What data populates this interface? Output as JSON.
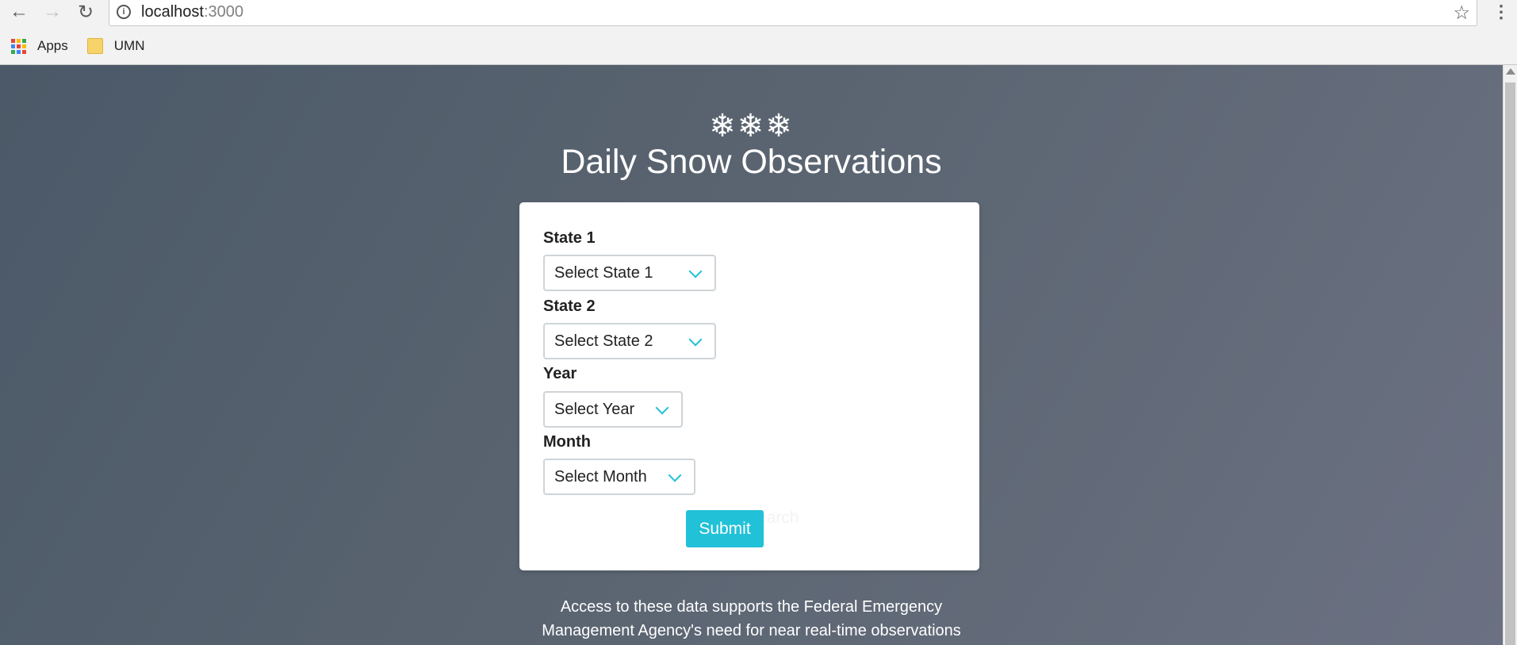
{
  "browser": {
    "url_host": "localhost",
    "url_port": ":3000",
    "bookmarks": [
      {
        "label": "Apps",
        "icon": "apps-grid-icon"
      },
      {
        "label": "UMN",
        "icon": "folder-icon"
      }
    ]
  },
  "header": {
    "snowflakes": "❄❄❄",
    "title": "Daily Snow Observations"
  },
  "form": {
    "fields": [
      {
        "label": "State 1",
        "placeholder": "Select State 1"
      },
      {
        "label": "State 2",
        "placeholder": "Select State 2"
      },
      {
        "label": "Year",
        "placeholder": "Select Year"
      },
      {
        "label": "Month",
        "placeholder": "Select Month"
      }
    ],
    "submit_label": "Submit",
    "ghost_text": "earch"
  },
  "footer": {
    "line1": "Access to these data supports the Federal Emergency",
    "line2": "Management Agency's need for near real-time observations"
  },
  "colors": {
    "accent": "#21c1d7",
    "page_gradient_start": "#4b5968",
    "page_gradient_end": "#6b7182"
  }
}
